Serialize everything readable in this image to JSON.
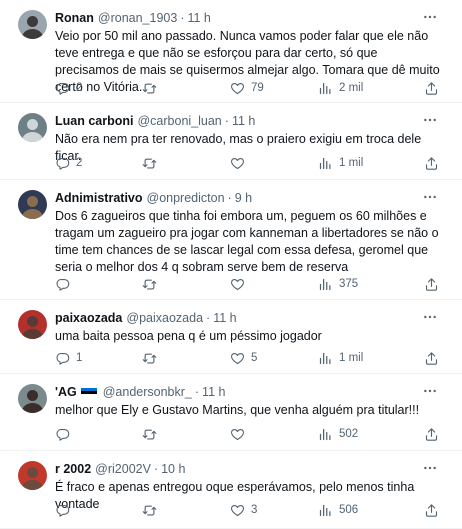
{
  "tweets": [
    {
      "name": "Ronan",
      "handle": "@ronan_1903",
      "time": "11 h",
      "text": "Veio por 50 mil ano passado. Nunca vamos poder falar que ele não teve entrega e que não se esforçou para dar certo, só que precisamos de mais se quisermos almejar algo. Tomara que dê muito certo no Vitória.",
      "replies": "2",
      "retweets": "",
      "likes": "79",
      "views": "2 mil",
      "avatar_colors": [
        "#9aa6ad",
        "#3b3b3b"
      ]
    },
    {
      "name": "Luan carboni",
      "handle": "@carboni_luan",
      "time": "11 h",
      "text": "Não era nem pra ter renovado, mas o praiero exigiu em troca dele ficar.",
      "replies": "2",
      "retweets": "",
      "likes": "",
      "views": "1 mil",
      "avatar_colors": [
        "#6f7f86",
        "#cfd6da"
      ]
    },
    {
      "name": "Adnimistrativo",
      "handle": "@onpredicton",
      "time": "9 h",
      "text": "Dos 6 zagueiros que tinha foi embora um, peguem os 60 milhões e tragam um zagueiro pra jogar com kanneman a libertadores se não o time tem chances de se lascar legal com essa defesa, geromel que seria o melhor dos 4 q sobram serve bem de reserva",
      "replies": "",
      "retweets": "",
      "likes": "",
      "views": "375",
      "avatar_colors": [
        "#2f3b55",
        "#8a6d4e"
      ]
    },
    {
      "name": "paixaozada",
      "handle": "@paixaozada",
      "time": "11 h",
      "text": "uma baita pessoa pena q é um péssimo jogador",
      "replies": "1",
      "retweets": "",
      "likes": "5",
      "views": "1 mil",
      "avatar_colors": [
        "#b3302c",
        "#5a3a34"
      ]
    },
    {
      "name": "'AG",
      "handle": "@andersonbkr_",
      "time": "11 h",
      "text": "melhor que Ely e Gustavo Martins, que venha alguém pra titular!!!",
      "replies": "",
      "retweets": "",
      "likes": "",
      "views": "502",
      "avatar_colors": [
        "#7b8a8c",
        "#3a2e2a"
      ]
    },
    {
      "name": "r 2002",
      "handle": "@ri2002V",
      "time": "10 h",
      "text": "É fraco e apenas entregou oque esperávamos, pelo menos tinha vontade",
      "replies": "",
      "retweets": "",
      "likes": "3",
      "views": "506",
      "avatar_colors": [
        "#c0392b",
        "#6b4a3f"
      ]
    }
  ],
  "flag_colors": [
    "#0072ce",
    "#000000",
    "#ffffff"
  ],
  "icons": {
    "more": "more-horizontal-icon",
    "reply": "reply-icon",
    "retweet": "retweet-icon",
    "like": "heart-icon",
    "views": "views-chart-icon",
    "share": "share-icon"
  }
}
